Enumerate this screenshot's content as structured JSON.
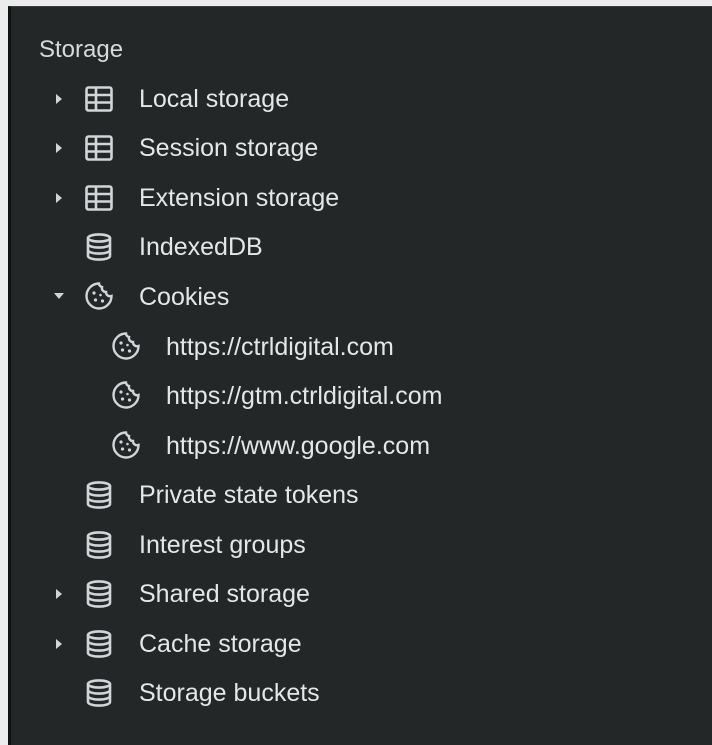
{
  "panel": {
    "section_title": "Storage"
  },
  "items": [
    {
      "label": "Local storage",
      "icon": "table-icon",
      "arrow": "collapsed"
    },
    {
      "label": "Session storage",
      "icon": "table-icon",
      "arrow": "collapsed"
    },
    {
      "label": "Extension storage",
      "icon": "table-icon",
      "arrow": "collapsed"
    },
    {
      "label": "IndexedDB",
      "icon": "database-icon",
      "arrow": "none"
    },
    {
      "label": "Cookies",
      "icon": "cookie-icon",
      "arrow": "expanded"
    },
    {
      "label": "https://ctrldigital.com",
      "icon": "cookie-icon",
      "arrow": "none"
    },
    {
      "label": "https://gtm.ctrldigital.com",
      "icon": "cookie-icon",
      "arrow": "none"
    },
    {
      "label": "https://www.google.com",
      "icon": "cookie-icon",
      "arrow": "none"
    },
    {
      "label": "Private state tokens",
      "icon": "database-icon",
      "arrow": "none"
    },
    {
      "label": "Interest groups",
      "icon": "database-icon",
      "arrow": "none"
    },
    {
      "label": "Shared storage",
      "icon": "database-icon",
      "arrow": "collapsed"
    },
    {
      "label": "Cache storage",
      "icon": "database-icon",
      "arrow": "collapsed"
    },
    {
      "label": "Storage buckets",
      "icon": "database-icon",
      "arrow": "none"
    }
  ],
  "colors": {
    "panel_bg": "#232728",
    "text": "#e4e6e8",
    "icon": "#d2d5d8"
  }
}
